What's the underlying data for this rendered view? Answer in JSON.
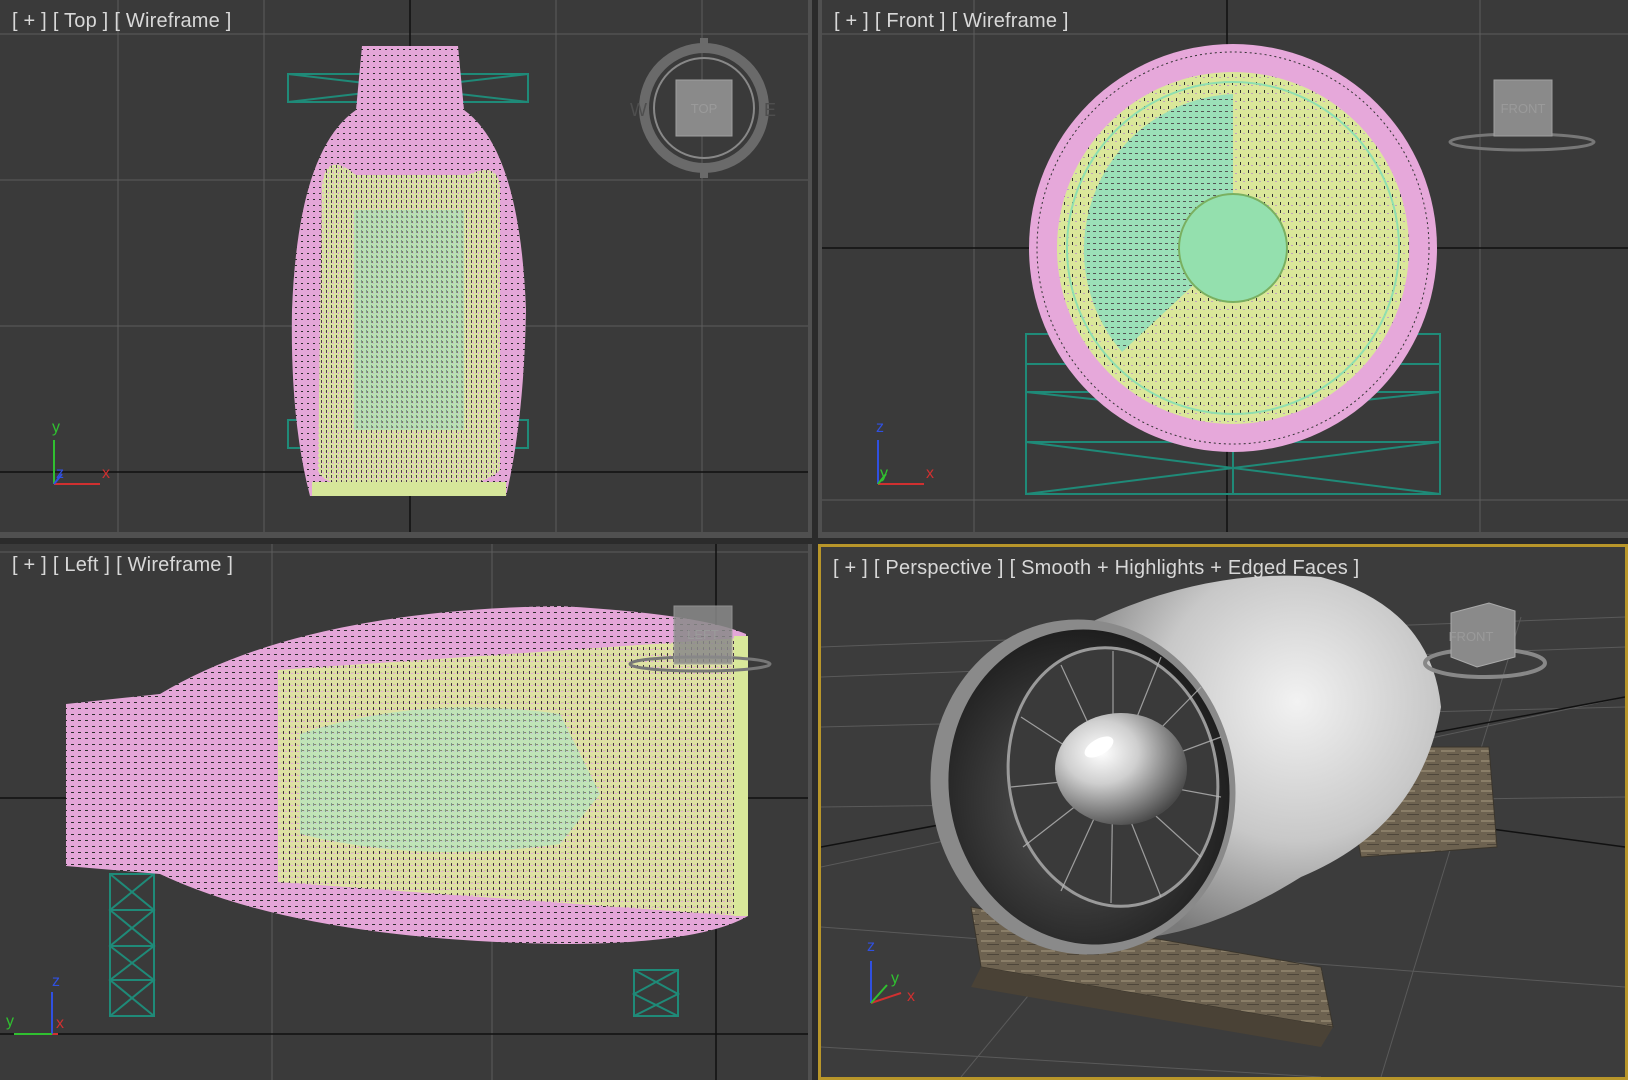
{
  "viewports": {
    "top": {
      "plus": "[ + ]",
      "view": "[ Top ]",
      "mode": "[ Wireframe ]",
      "cube_label": "TOP"
    },
    "front": {
      "plus": "[ + ]",
      "view": "[ Front ]",
      "mode": "[ Wireframe ]",
      "cube_label": "FRONT"
    },
    "left": {
      "plus": "[ + ]",
      "view": "[ Left ]",
      "mode": "[ Wireframe ]",
      "cube_label": "LEFT"
    },
    "perspective": {
      "plus": "[ + ]",
      "view": "[ Perspective ]",
      "mode": "[ Smooth + Highlights + Edged Faces ]",
      "cube_label": "FRONT"
    }
  },
  "axes": {
    "top": [
      "y",
      "z",
      "x"
    ],
    "front": [
      "z",
      "y",
      "x"
    ],
    "left": [
      "z",
      "y",
      "x"
    ],
    "perspective": [
      "z",
      "y",
      "x"
    ]
  },
  "viewcube_compass": {
    "west": "W",
    "east": "E"
  },
  "colors": {
    "viewport_bg": "#3a3a3a",
    "grid": "#5a5a5a",
    "grid_axis": "#111111",
    "nacelle_wire": "#e8a8dc",
    "fan_wire": "#d8e898",
    "spinner_wire": "#8fdfb0",
    "stand_wire": "#1f8a78",
    "active_border": "#b8962a",
    "axis_x": "#d03030",
    "axis_y": "#30c030",
    "axis_z": "#3050e0"
  }
}
